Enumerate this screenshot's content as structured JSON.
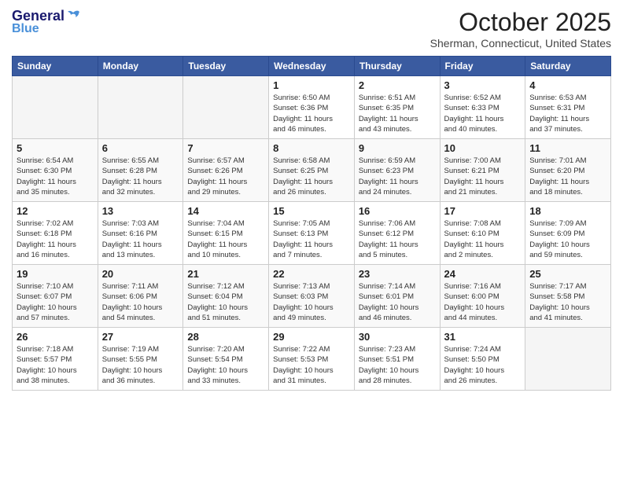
{
  "header": {
    "logo_line1": "General",
    "logo_line2": "Blue",
    "month": "October 2025",
    "location": "Sherman, Connecticut, United States"
  },
  "days_of_week": [
    "Sunday",
    "Monday",
    "Tuesday",
    "Wednesday",
    "Thursday",
    "Friday",
    "Saturday"
  ],
  "weeks": [
    [
      {
        "day": "",
        "info": ""
      },
      {
        "day": "",
        "info": ""
      },
      {
        "day": "",
        "info": ""
      },
      {
        "day": "1",
        "info": "Sunrise: 6:50 AM\nSunset: 6:36 PM\nDaylight: 11 hours\nand 46 minutes."
      },
      {
        "day": "2",
        "info": "Sunrise: 6:51 AM\nSunset: 6:35 PM\nDaylight: 11 hours\nand 43 minutes."
      },
      {
        "day": "3",
        "info": "Sunrise: 6:52 AM\nSunset: 6:33 PM\nDaylight: 11 hours\nand 40 minutes."
      },
      {
        "day": "4",
        "info": "Sunrise: 6:53 AM\nSunset: 6:31 PM\nDaylight: 11 hours\nand 37 minutes."
      }
    ],
    [
      {
        "day": "5",
        "info": "Sunrise: 6:54 AM\nSunset: 6:30 PM\nDaylight: 11 hours\nand 35 minutes."
      },
      {
        "day": "6",
        "info": "Sunrise: 6:55 AM\nSunset: 6:28 PM\nDaylight: 11 hours\nand 32 minutes."
      },
      {
        "day": "7",
        "info": "Sunrise: 6:57 AM\nSunset: 6:26 PM\nDaylight: 11 hours\nand 29 minutes."
      },
      {
        "day": "8",
        "info": "Sunrise: 6:58 AM\nSunset: 6:25 PM\nDaylight: 11 hours\nand 26 minutes."
      },
      {
        "day": "9",
        "info": "Sunrise: 6:59 AM\nSunset: 6:23 PM\nDaylight: 11 hours\nand 24 minutes."
      },
      {
        "day": "10",
        "info": "Sunrise: 7:00 AM\nSunset: 6:21 PM\nDaylight: 11 hours\nand 21 minutes."
      },
      {
        "day": "11",
        "info": "Sunrise: 7:01 AM\nSunset: 6:20 PM\nDaylight: 11 hours\nand 18 minutes."
      }
    ],
    [
      {
        "day": "12",
        "info": "Sunrise: 7:02 AM\nSunset: 6:18 PM\nDaylight: 11 hours\nand 16 minutes."
      },
      {
        "day": "13",
        "info": "Sunrise: 7:03 AM\nSunset: 6:16 PM\nDaylight: 11 hours\nand 13 minutes."
      },
      {
        "day": "14",
        "info": "Sunrise: 7:04 AM\nSunset: 6:15 PM\nDaylight: 11 hours\nand 10 minutes."
      },
      {
        "day": "15",
        "info": "Sunrise: 7:05 AM\nSunset: 6:13 PM\nDaylight: 11 hours\nand 7 minutes."
      },
      {
        "day": "16",
        "info": "Sunrise: 7:06 AM\nSunset: 6:12 PM\nDaylight: 11 hours\nand 5 minutes."
      },
      {
        "day": "17",
        "info": "Sunrise: 7:08 AM\nSunset: 6:10 PM\nDaylight: 11 hours\nand 2 minutes."
      },
      {
        "day": "18",
        "info": "Sunrise: 7:09 AM\nSunset: 6:09 PM\nDaylight: 10 hours\nand 59 minutes."
      }
    ],
    [
      {
        "day": "19",
        "info": "Sunrise: 7:10 AM\nSunset: 6:07 PM\nDaylight: 10 hours\nand 57 minutes."
      },
      {
        "day": "20",
        "info": "Sunrise: 7:11 AM\nSunset: 6:06 PM\nDaylight: 10 hours\nand 54 minutes."
      },
      {
        "day": "21",
        "info": "Sunrise: 7:12 AM\nSunset: 6:04 PM\nDaylight: 10 hours\nand 51 minutes."
      },
      {
        "day": "22",
        "info": "Sunrise: 7:13 AM\nSunset: 6:03 PM\nDaylight: 10 hours\nand 49 minutes."
      },
      {
        "day": "23",
        "info": "Sunrise: 7:14 AM\nSunset: 6:01 PM\nDaylight: 10 hours\nand 46 minutes."
      },
      {
        "day": "24",
        "info": "Sunrise: 7:16 AM\nSunset: 6:00 PM\nDaylight: 10 hours\nand 44 minutes."
      },
      {
        "day": "25",
        "info": "Sunrise: 7:17 AM\nSunset: 5:58 PM\nDaylight: 10 hours\nand 41 minutes."
      }
    ],
    [
      {
        "day": "26",
        "info": "Sunrise: 7:18 AM\nSunset: 5:57 PM\nDaylight: 10 hours\nand 38 minutes."
      },
      {
        "day": "27",
        "info": "Sunrise: 7:19 AM\nSunset: 5:55 PM\nDaylight: 10 hours\nand 36 minutes."
      },
      {
        "day": "28",
        "info": "Sunrise: 7:20 AM\nSunset: 5:54 PM\nDaylight: 10 hours\nand 33 minutes."
      },
      {
        "day": "29",
        "info": "Sunrise: 7:22 AM\nSunset: 5:53 PM\nDaylight: 10 hours\nand 31 minutes."
      },
      {
        "day": "30",
        "info": "Sunrise: 7:23 AM\nSunset: 5:51 PM\nDaylight: 10 hours\nand 28 minutes."
      },
      {
        "day": "31",
        "info": "Sunrise: 7:24 AM\nSunset: 5:50 PM\nDaylight: 10 hours\nand 26 minutes."
      },
      {
        "day": "",
        "info": ""
      }
    ]
  ]
}
